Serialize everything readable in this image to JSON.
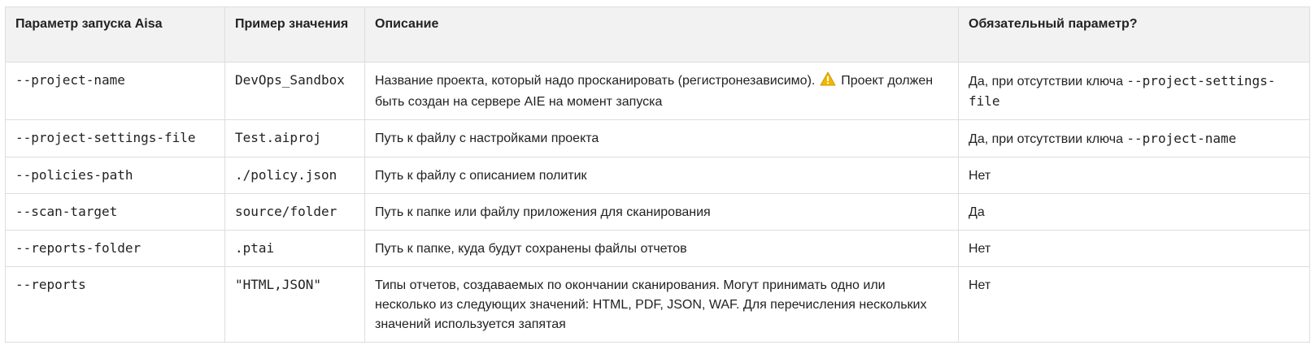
{
  "headers": {
    "param": "Параметр запуска Aisa",
    "example": "Пример значения",
    "description": "Описание",
    "required": "Обязательный параметр?"
  },
  "rows": [
    {
      "param": "--project-name",
      "example": "DevOps_Sandbox",
      "description_before": "Название проекта, который надо просканировать (регистронезависимо).",
      "warning_icon": "warning-icon",
      "description_after": " Проект должен быть создан на сервере AIE на момент запуска",
      "required_text": "Да, при отсутствии ключа ",
      "required_code": "--project-settings-file"
    },
    {
      "param": "--project-settings-file",
      "example": "Test.aiproj",
      "description": "Путь к файлу с настройками проекта",
      "required_text": "Да, при отсутствии ключа ",
      "required_code": "--project-name"
    },
    {
      "param": "--policies-path",
      "example": "./policy.json",
      "description": "Путь к файлу с описанием политик",
      "required_text": "Нет"
    },
    {
      "param": "--scan-target",
      "example": "source/folder",
      "description": "Путь к папке или файлу приложения для сканирования",
      "required_text": "Да"
    },
    {
      "param": "--reports-folder",
      "example": ".ptai",
      "description": "Путь к папке, куда будут сохранены файлы отчетов",
      "required_text": "Нет"
    },
    {
      "param": "--reports",
      "example": "\"HTML,JSON\"",
      "description": "Типы отчетов, создаваемых по окончании сканирования. Могут принимать одно или несколько из следующих значений: HTML, PDF, JSON, WAF. Для перечисления нескольких значений используется запятая",
      "required_text": "Нет"
    }
  ],
  "colors": {
    "header_bg": "#f2f2f2",
    "border": "#dddddd",
    "text": "#222222",
    "warning": "#f2b600"
  }
}
